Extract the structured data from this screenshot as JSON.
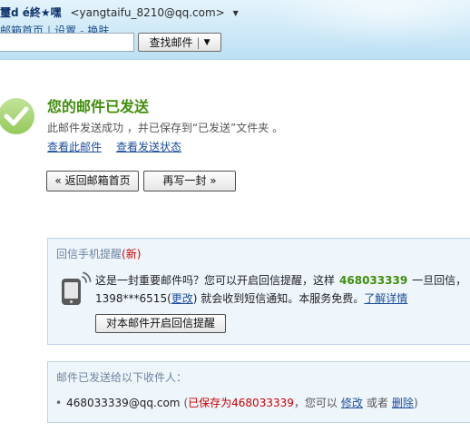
{
  "header": {
    "nickname": "璽d é終★嘿",
    "email": "<yangtaifu_8210@qq.com>",
    "account_menu_glyph": "▼",
    "nav": {
      "home": "邮箱首页",
      "sep1": "|",
      "settings": "设置",
      "sep2": "-",
      "skin": "换肤"
    },
    "search": {
      "value": "",
      "button_label": "查找邮件",
      "button_sep": "|",
      "dropdown_glyph": "▼"
    }
  },
  "success": {
    "title": "您的邮件已发送",
    "description": "此邮件发送成功 ，并已保存到“已发送”文件夹 。",
    "view_mail_link": "查看此邮件",
    "view_status_link": "查看发送状态",
    "back_button": "« 返回邮箱首页",
    "compose_button": "再写一封 »"
  },
  "reply_reminder": {
    "title": "回信手机提醒",
    "new_badge": "(新)",
    "line1_prefix": "这是一封重要邮件吗？您可以开启回信提醒，这样",
    "contact_qq": "468033339",
    "line1_suffix": "一旦回信，",
    "phone": "1398***6515(",
    "change_link": "更改",
    "line2_text": ") 就会收到短信通知。本服务免费。",
    "learn_more_link": "了解详情",
    "enable_button": "对本邮件开启回信提醒"
  },
  "recipients": {
    "title": "邮件已发送给以下收件人：",
    "bullet": "•",
    "items": [
      {
        "email": "468033339@qq.com",
        "open_paren": "(",
        "saved_note": "已保存为468033339",
        "hint": "，您可以",
        "edit_link": "修改",
        "or": "或者",
        "delete_link": "删除",
        "close_paren": ")"
      }
    ]
  },
  "colors": {
    "title_green": "#3f8f0a",
    "link_blue": "#1d4f9e",
    "alert_red": "#cc0000",
    "box_bg": "#eef5fb",
    "box_border": "#bdd2e8",
    "box_title": "#6d84a1"
  },
  "icons": {
    "success": "check-circle-icon",
    "account_menu": "triangle-down-icon",
    "search_dropdown": "triangle-down-icon",
    "reminder": "mobile-phone-icon"
  }
}
